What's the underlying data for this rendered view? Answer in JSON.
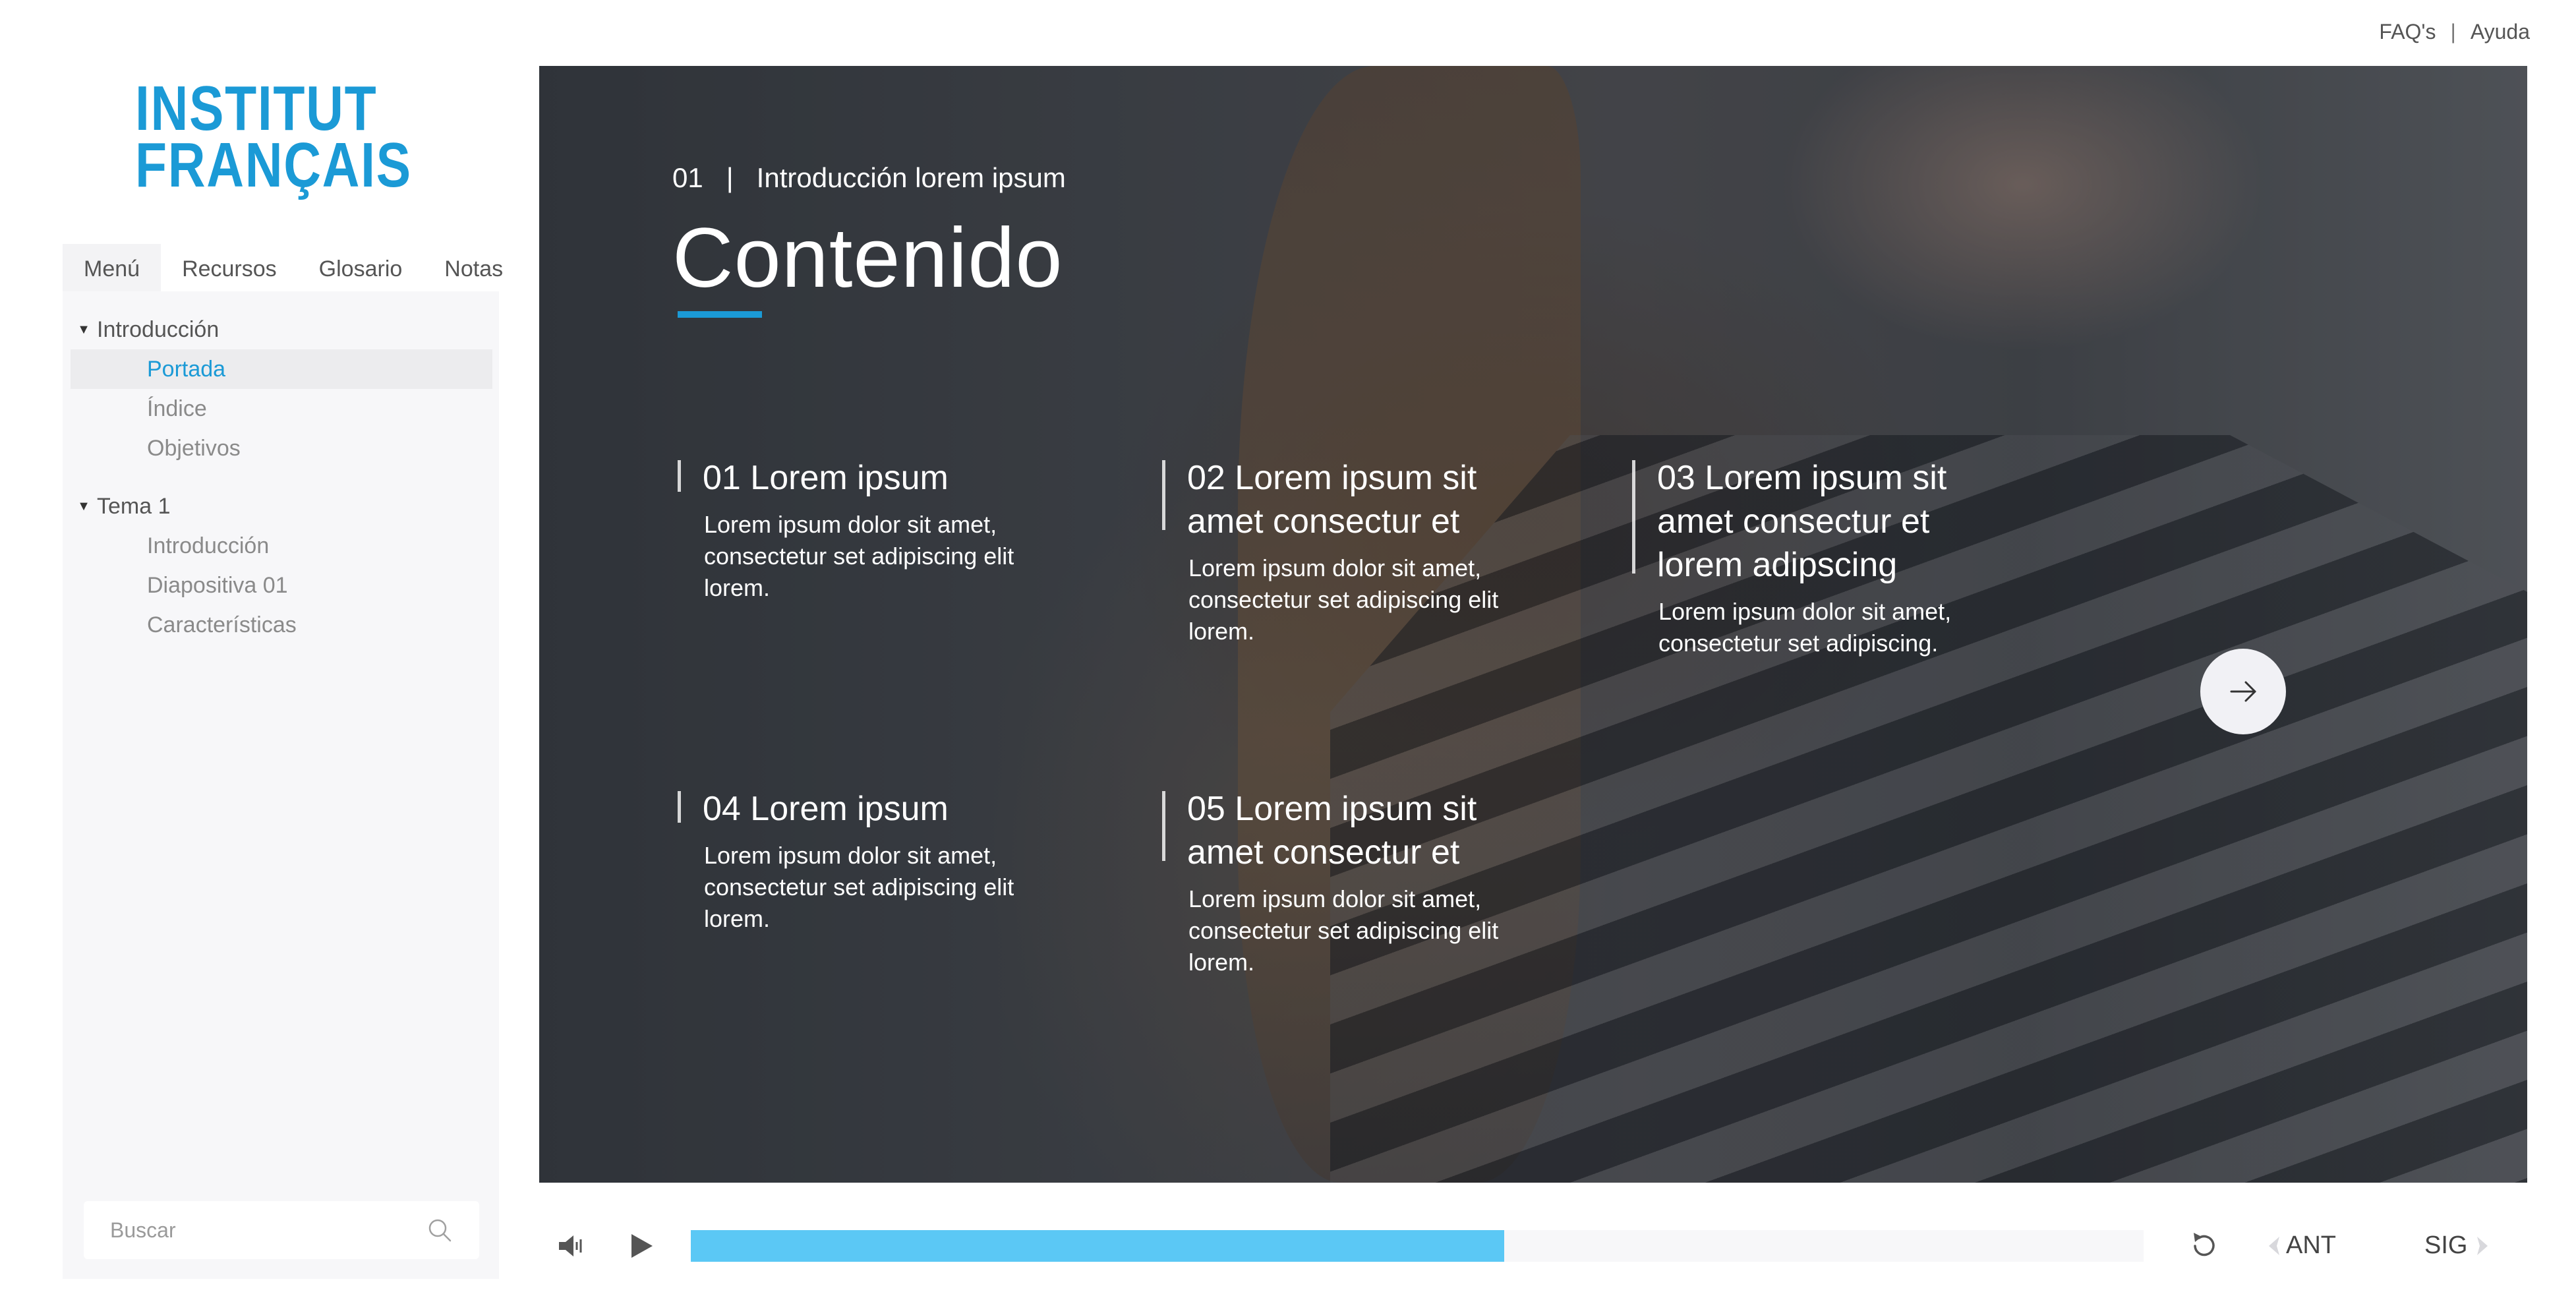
{
  "top_links": {
    "faq": "FAQ's",
    "sep": "|",
    "help": "Ayuda"
  },
  "logo": {
    "line1": "INSTITUT",
    "line2": "FRANÇAIS"
  },
  "sidebar": {
    "tabs": [
      "Menú",
      "Recursos",
      "Glosario",
      "Notas"
    ],
    "active_tab": "Menú",
    "tree": [
      {
        "label": "Introducción",
        "children": [
          "Portada",
          "Índice",
          "Objetivos"
        ]
      },
      {
        "label": "Tema 1",
        "children": [
          "Introducción",
          "Diapositiva 01",
          "Características"
        ]
      }
    ],
    "active_item": "Portada",
    "search_placeholder": "Buscar"
  },
  "slide": {
    "head_number": "01",
    "head_sep": "|",
    "head_text": "Introducción lorem ipsum",
    "title": "Contenido",
    "items": [
      {
        "title": "01 Lorem ipsum",
        "body": "Lorem ipsum dolor sit amet, consectetur set adipiscing elit lorem."
      },
      {
        "title": "02 Lorem ipsum sit amet consectur et",
        "body": "Lorem ipsum dolor sit amet, consectetur set adipiscing elit lorem."
      },
      {
        "title": "03 Lorem ipsum sit amet consectur et lorem adipscing",
        "body": "Lorem ipsum dolor sit amet, consectetur set adipiscing."
      },
      {
        "title": "04 Lorem ipsum",
        "body": "Lorem ipsum dolor sit amet, consectetur set adipiscing elit lorem."
      },
      {
        "title": "05 Lorem ipsum sit amet consectur et",
        "body": "Lorem ipsum dolor sit amet, consectetur set adipiscing elit lorem."
      }
    ]
  },
  "player": {
    "progress": 0.56,
    "prev_label": "ANT",
    "next_label": "SIG"
  },
  "colors": {
    "accent": "#1b9ad6",
    "progress": "#5bc8f5"
  }
}
